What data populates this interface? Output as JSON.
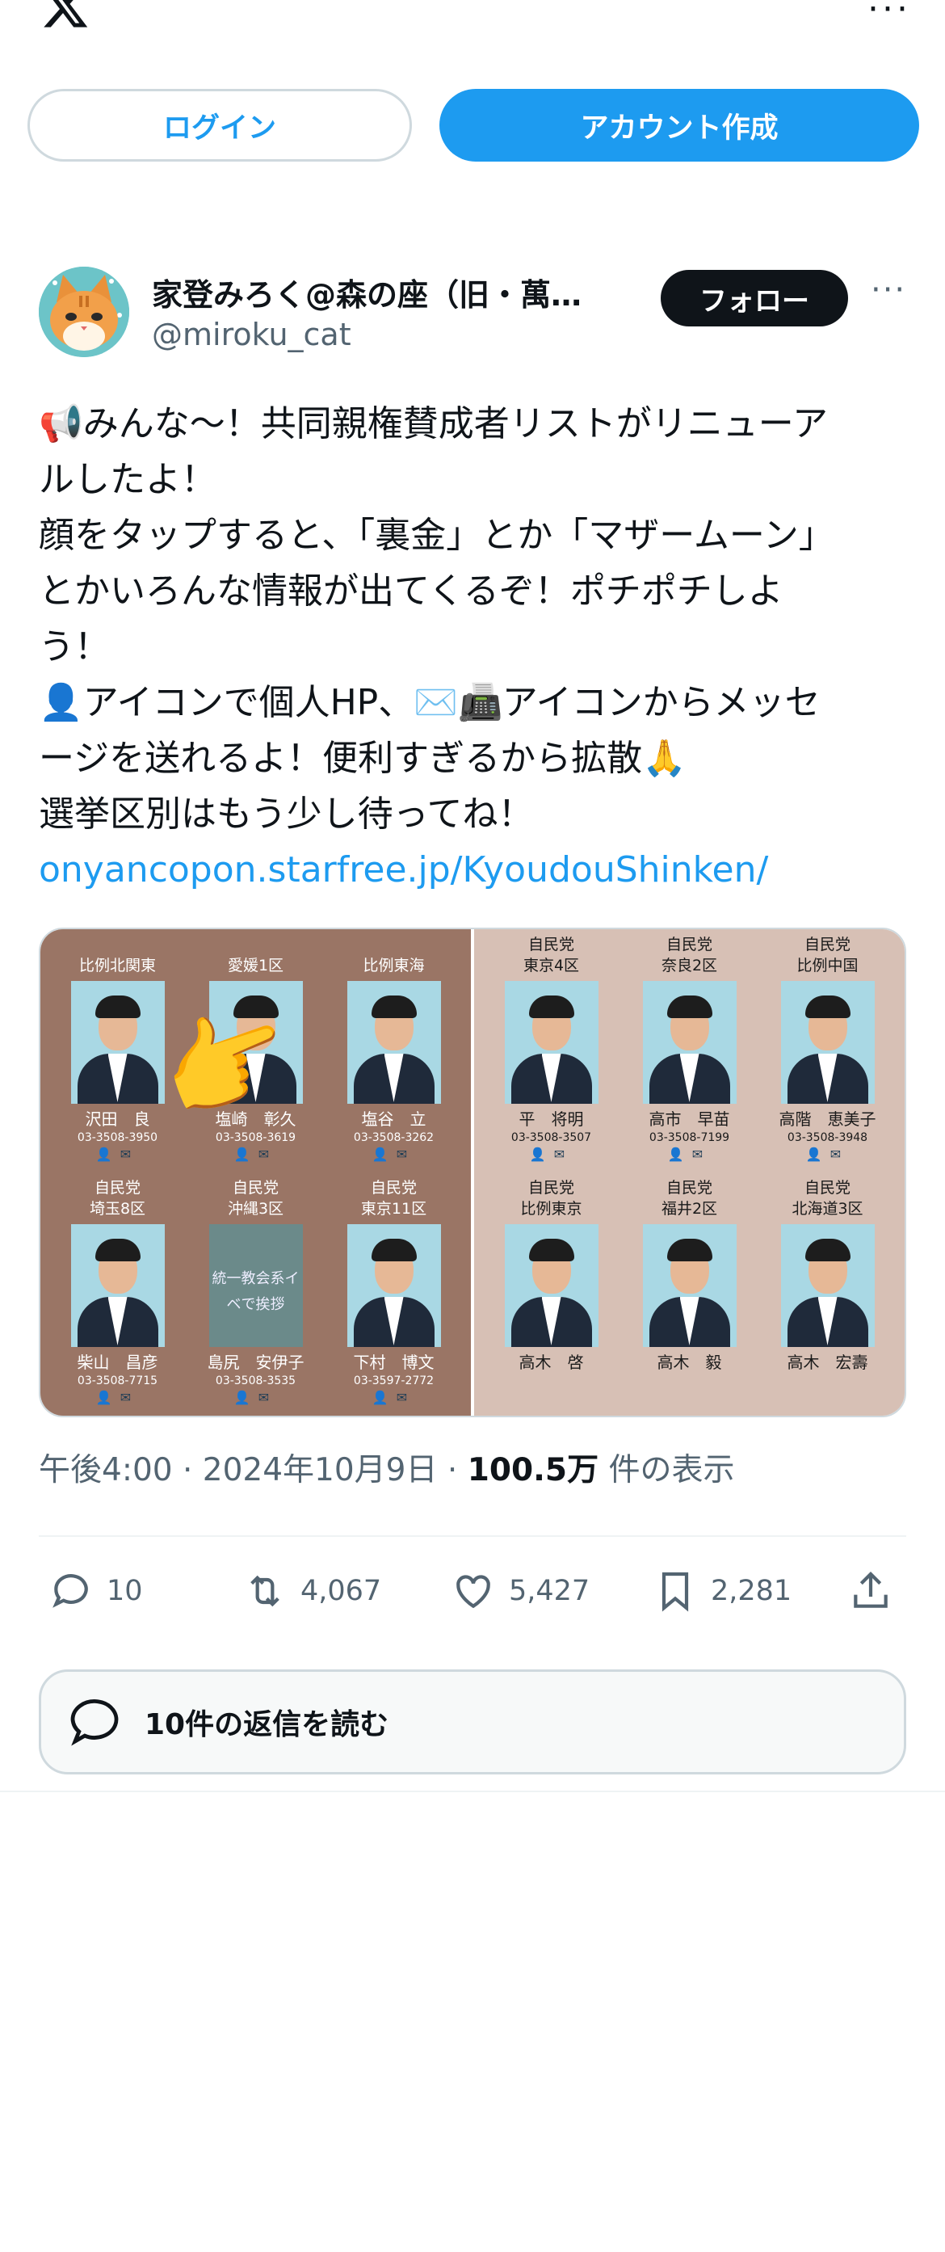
{
  "header": {
    "logo": "x-logo",
    "more_icon": "more-horizontal-icon"
  },
  "auth": {
    "login_label": "ログイン",
    "create_account_label": "アカウント作成"
  },
  "post": {
    "author_name": "家登みろく@森の座（旧・萬…",
    "author_handle": "@miroku_cat",
    "follow_label": "フォロー",
    "text_lines": [
      "📢みんな〜！共同親権賛成者リストがリニューア",
      "ルしたよ！",
      "顔をタップすると、「裏金」とか「マザームーン」",
      "とかいろんな情報が出てくるぞ！ポチポチしよ",
      "う！",
      "👤アイコンで個人HP、✉️📠アイコンからメッセ",
      "ージを送れるよ！便利すぎるから拡散🙏",
      "選挙区別はもう少し待ってね！"
    ],
    "link": "onyancopon.starfree.jp/KyoudouShinken/",
    "meta": {
      "time": "午後4:00",
      "date": "2024年10月9日",
      "views_count": "100.5万",
      "views_label": "件の表示"
    },
    "actions": {
      "replies": "10",
      "reposts": "4,067",
      "likes": "5,427",
      "bookmarks": "2,281"
    },
    "read_replies_label": "10件の返信を読む"
  },
  "media": {
    "left": [
      {
        "party": "比例北関東",
        "name": "沢田　良",
        "phone": "03-3508-3950"
      },
      {
        "party": "愛媛1区",
        "name": "塩崎　彰久",
        "phone": "03-3508-3619"
      },
      {
        "party": "比例東海",
        "name": "塩谷　立",
        "phone": "03-3508-3262"
      },
      {
        "party": "自民党\n埼玉8区",
        "name": "柴山　昌彦",
        "phone": "03-3508-7715"
      },
      {
        "party": "自民党\n沖縄3区",
        "name": "島尻　安伊子",
        "phone": "03-3508-3535",
        "overlay": "統一教会系イ\nベで挨拶"
      },
      {
        "party": "自民党\n東京11区",
        "name": "下村　博文",
        "phone": "03-3597-2772"
      }
    ],
    "right": [
      {
        "party": "自民党\n東京4区",
        "name": "平　将明",
        "phone": "03-3508-3507"
      },
      {
        "party": "自民党\n奈良2区",
        "name": "高市　早苗",
        "phone": "03-3508-7199"
      },
      {
        "party": "自民党\n比例中国",
        "name": "高階　恵美子",
        "phone": "03-3508-3948"
      },
      {
        "party": "自民党\n比例東京",
        "name": "高木　啓",
        "phone": ""
      },
      {
        "party": "自民党\n福井2区",
        "name": "高木　毅",
        "phone": ""
      },
      {
        "party": "自民党\n北海道3区",
        "name": "高木　宏壽",
        "phone": ""
      }
    ]
  }
}
